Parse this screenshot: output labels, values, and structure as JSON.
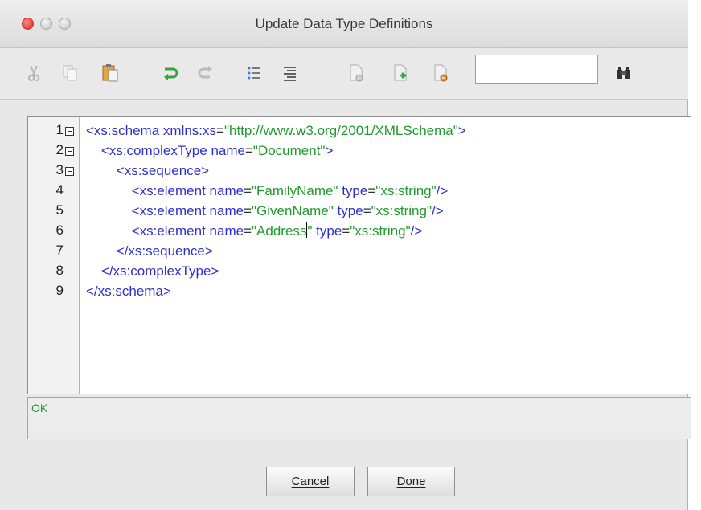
{
  "window": {
    "title": "Update Data Type Definitions"
  },
  "toolbar": {
    "icons": [
      "cut-icon",
      "copy-icon",
      "paste-icon",
      "undo-icon",
      "redo-icon",
      "list-icon",
      "align-icon",
      "new-doc-icon",
      "import-icon",
      "delete-doc-icon",
      "binoculars-icon"
    ],
    "search_value": ""
  },
  "editor": {
    "line_numbers": [
      "1",
      "2",
      "3",
      "4",
      "5",
      "6",
      "7",
      "8",
      "9"
    ],
    "lines": [
      [
        [
          "tag",
          "<xs:schema "
        ],
        [
          "attr",
          "xmlns:xs"
        ],
        [
          "eq",
          "="
        ],
        [
          "val",
          "\"http://www.w3.org/2001/XMLSchema\""
        ],
        [
          "tag",
          ">"
        ]
      ],
      [
        [
          "tag",
          "    <xs:complexType "
        ],
        [
          "attr",
          "name"
        ],
        [
          "eq",
          "="
        ],
        [
          "val",
          "\"Document\""
        ],
        [
          "tag",
          ">"
        ]
      ],
      [
        [
          "tag",
          "        <xs:sequence>"
        ]
      ],
      [
        [
          "tag",
          "            <xs:element "
        ],
        [
          "attr",
          "name"
        ],
        [
          "eq",
          "="
        ],
        [
          "val",
          "\"FamilyName\""
        ],
        [
          "attr",
          " type"
        ],
        [
          "eq",
          "="
        ],
        [
          "val",
          "\"xs:string\""
        ],
        [
          "tag",
          "/>"
        ]
      ],
      [
        [
          "tag",
          "            <xs:element "
        ],
        [
          "attr",
          "name"
        ],
        [
          "eq",
          "="
        ],
        [
          "val",
          "\"GivenName\""
        ],
        [
          "attr",
          " type"
        ],
        [
          "eq",
          "="
        ],
        [
          "val",
          "\"xs:string\""
        ],
        [
          "tag",
          "/>"
        ]
      ],
      [
        [
          "tag",
          "            <xs:element "
        ],
        [
          "attr",
          "name"
        ],
        [
          "eq",
          "="
        ],
        [
          "val",
          "\"Address"
        ],
        [
          "caret",
          ""
        ],
        [
          "val",
          "\""
        ],
        [
          "attr",
          " type"
        ],
        [
          "eq",
          "="
        ],
        [
          "val",
          "\"xs:string\""
        ],
        [
          "tag",
          "/>"
        ]
      ],
      [
        [
          "tag",
          "        </xs:sequence>"
        ]
      ],
      [
        [
          "tag",
          "    </xs:complexType>"
        ]
      ],
      [
        [
          "tag",
          "</xs:schema>"
        ]
      ]
    ]
  },
  "status": {
    "text": "OK"
  },
  "buttons": {
    "cancel": "Cancel",
    "done": "Done"
  },
  "colors": {
    "tag": "#2f2fd0",
    "value": "#1f9a2b",
    "status": "#1f9a2b"
  }
}
